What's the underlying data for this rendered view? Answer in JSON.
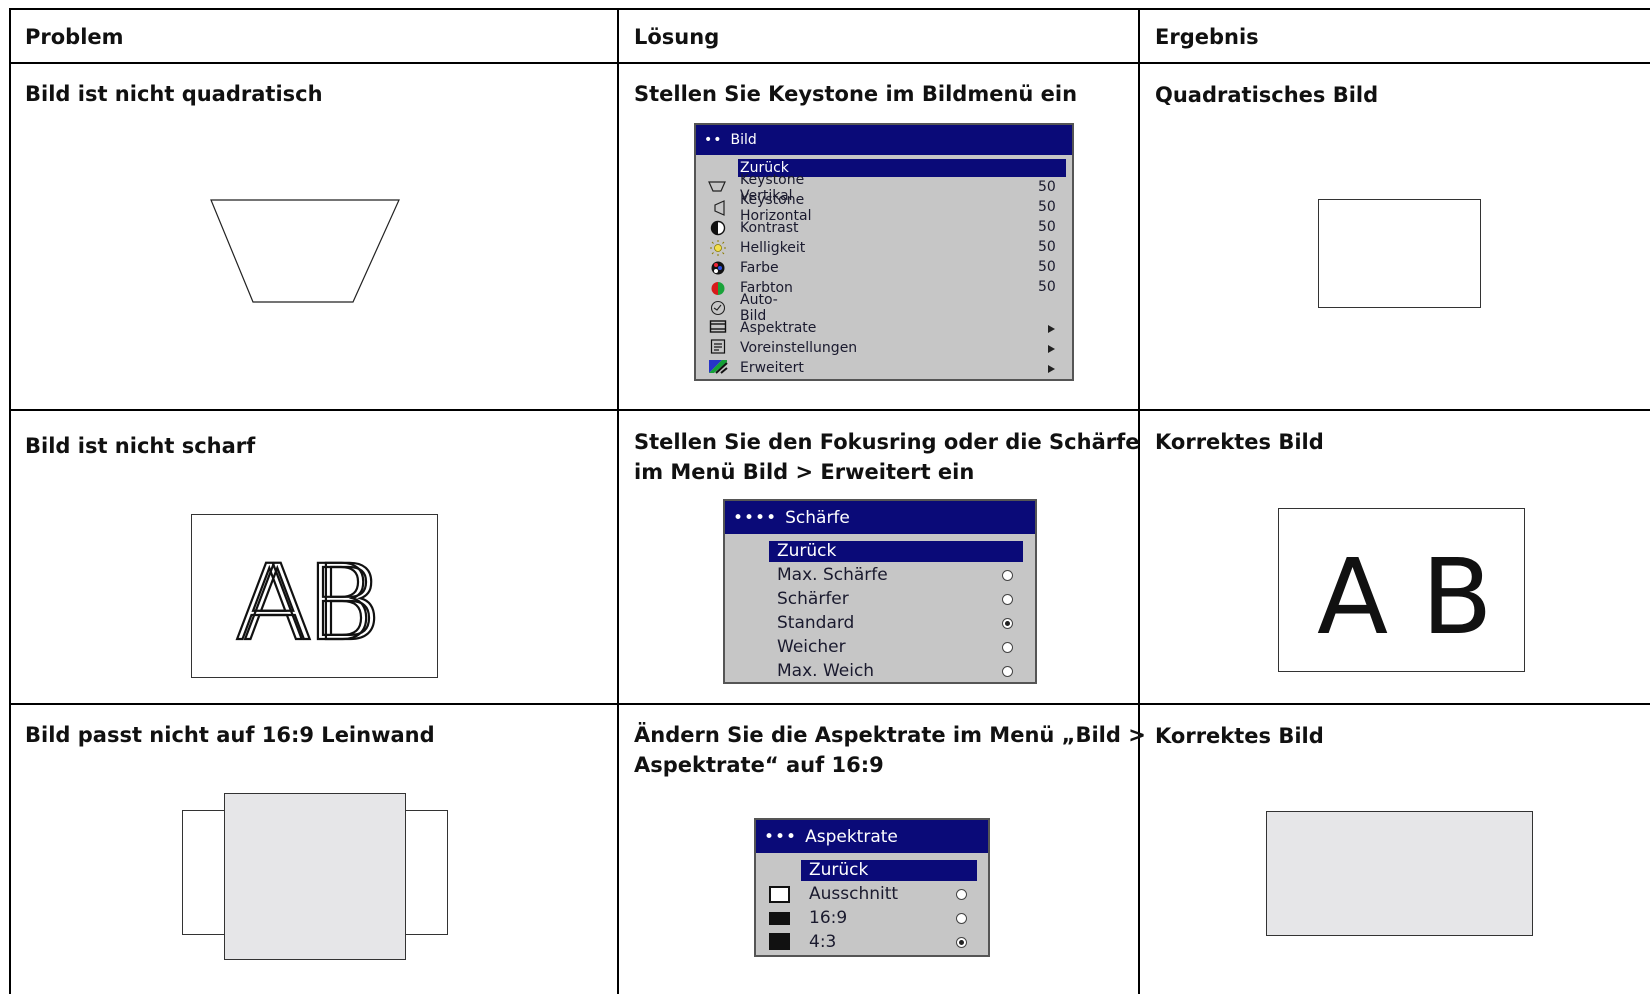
{
  "table": {
    "headers": {
      "problem": "Problem",
      "solution": "Lösung",
      "result": "Ergebnis"
    },
    "rows": [
      {
        "problem": "Bild ist nicht quadratisch",
        "solution": "Stellen Sie Keystone im Bildmenü ein",
        "result": "Quadratisches Bild"
      },
      {
        "problem": "Bild ist nicht scharf",
        "solution_line1": "Stellen Sie den Fokusring oder die Schärfe",
        "solution_line2": "im Menü Bild > Erweitert ein",
        "result": "Korrektes Bild"
      },
      {
        "problem": "Bild passt nicht auf 16:9 Leinwand",
        "solution_line1": "Ändern Sie die Aspektrate im Menü „Bild >",
        "solution_line2": "Aspektrate“ auf 16:9",
        "result": "Korrektes Bild"
      }
    ]
  },
  "menu_bild": {
    "dots": "••",
    "title": "Bild",
    "selected": "Zurück",
    "items": [
      {
        "label": "Keystone Vertikal",
        "value": "50"
      },
      {
        "label": "Keystone Horizontal",
        "value": "50"
      },
      {
        "label": "Kontrast",
        "value": "50"
      },
      {
        "label": "Helligkeit",
        "value": "50"
      },
      {
        "label": "Farbe",
        "value": "50"
      },
      {
        "label": "Farbton",
        "value": "50"
      },
      {
        "label": "Auto-Bild",
        "value": ""
      },
      {
        "label": "Aspektrate",
        "value": ""
      },
      {
        "label": "Voreinstellungen",
        "value": ""
      },
      {
        "label": "Erweitert",
        "value": ""
      }
    ]
  },
  "menu_schaerfe": {
    "dots": "••••",
    "title": "Schärfe",
    "selected": "Zurück",
    "items": [
      "Max. Schärfe",
      "Schärfer",
      "Standard",
      "Weicher",
      "Max. Weich"
    ],
    "checked": "Standard"
  },
  "menu_aspekt": {
    "dots": "•••",
    "title": "Aspektrate",
    "selected": "Zurück",
    "items": [
      "Ausschnitt",
      "16:9",
      "4:3"
    ],
    "checked": "4:3"
  },
  "illustrations": {
    "blurry_letters": "AB",
    "sharp_letters": "A B"
  },
  "colors": {
    "menu_title_bg": "#0a0a78",
    "menu_body_bg": "#c6c6c6",
    "image_fill": "#e6e6e8"
  }
}
